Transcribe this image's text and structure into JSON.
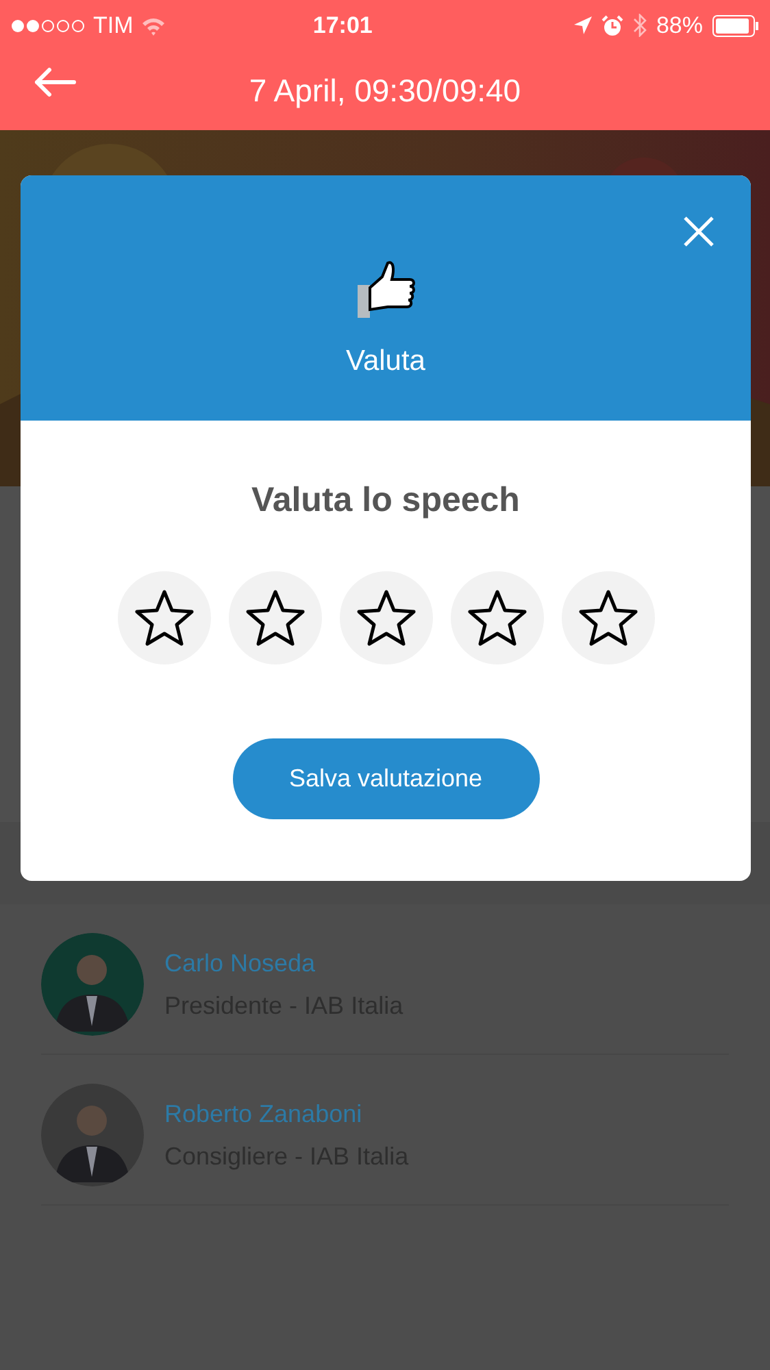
{
  "status_bar": {
    "carrier": "TIM",
    "time": "17:01",
    "battery": "88%"
  },
  "header": {
    "title": "7 April, 09:30/09:40"
  },
  "speakers": [
    {
      "name": "Carlo Noseda",
      "role": "Presidente - IAB Italia"
    },
    {
      "name": "Roberto Zanaboni",
      "role": "Consigliere - IAB Italia"
    }
  ],
  "modal": {
    "title": "Valuta",
    "heading": "Valuta lo speech",
    "stars": 0,
    "button": "Salva valutazione"
  }
}
